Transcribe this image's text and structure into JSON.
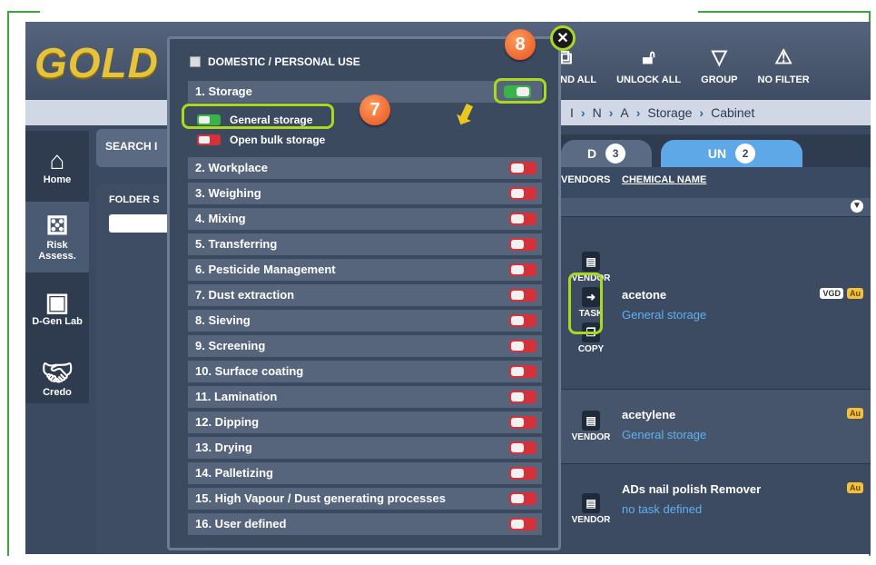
{
  "app": {
    "logo": "GOLD"
  },
  "toolbar": {
    "items": [
      {
        "label": "EXPAND ALL",
        "icon": "expand-icon"
      },
      {
        "label": "UNLOCK ALL",
        "icon": "unlock-icon"
      },
      {
        "label": "GROUP",
        "icon": "group-icon"
      },
      {
        "label": "NO FILTER",
        "icon": "warning-icon"
      }
    ]
  },
  "breadcrumb": {
    "items": [
      "I",
      "N",
      "A",
      "Storage",
      "Cabinet"
    ]
  },
  "nav": {
    "items": [
      {
        "label": "Home",
        "icon": "home-icon"
      },
      {
        "label": "Risk\nAssess.",
        "icon": "dice-icon"
      },
      {
        "label": "D-Gen Lab",
        "icon": "lab-icon"
      },
      {
        "label": "Credo",
        "icon": "handshake-icon"
      }
    ]
  },
  "search": {
    "label": "SEARCH I"
  },
  "folder": {
    "label": "FOLDER S"
  },
  "tabs": {
    "first_count": "3",
    "second_label": "UN",
    "second_count": "2"
  },
  "table": {
    "col_vendors": "VENDORS",
    "col_name": "CHEMICAL NAME",
    "rows": [
      {
        "name": "acetone",
        "task": "General storage",
        "badges": [
          "VGD",
          "Au"
        ],
        "actions": [
          "VENDOR",
          "TASK",
          "COPY"
        ]
      },
      {
        "name": "acetylene",
        "task": "General storage",
        "badges": [
          "Au"
        ],
        "actions": [
          "VENDOR"
        ]
      },
      {
        "name": "ADs nail polish Remover",
        "task": "no task defined",
        "badges": [
          "Au"
        ],
        "actions": [
          "VENDOR"
        ]
      }
    ]
  },
  "popup": {
    "title": "DOMESTIC / PERSONAL USE",
    "storage": {
      "label": "1. Storage",
      "on": true
    },
    "sub": [
      {
        "label": "General storage",
        "on": true
      },
      {
        "label": "Open bulk storage",
        "on": false
      }
    ],
    "categories": [
      "2. Workplace",
      "3. Weighing",
      "4. Mixing",
      "5. Transferring",
      "6. Pesticide Management",
      "7. Dust extraction",
      "8. Sieving",
      "9. Screening",
      "10. Surface coating",
      "11. Lamination",
      "12. Dipping",
      "13. Drying",
      "14. Palletizing",
      "15. High Vapour / Dust generating processes",
      "16. User defined"
    ]
  },
  "callouts": {
    "seven": "7",
    "eight": "8"
  },
  "colors": {
    "accent": "#a9d81e",
    "toggle_on": "#39b34a",
    "toggle_off": "#d5313b",
    "link": "#5fb0f0"
  }
}
